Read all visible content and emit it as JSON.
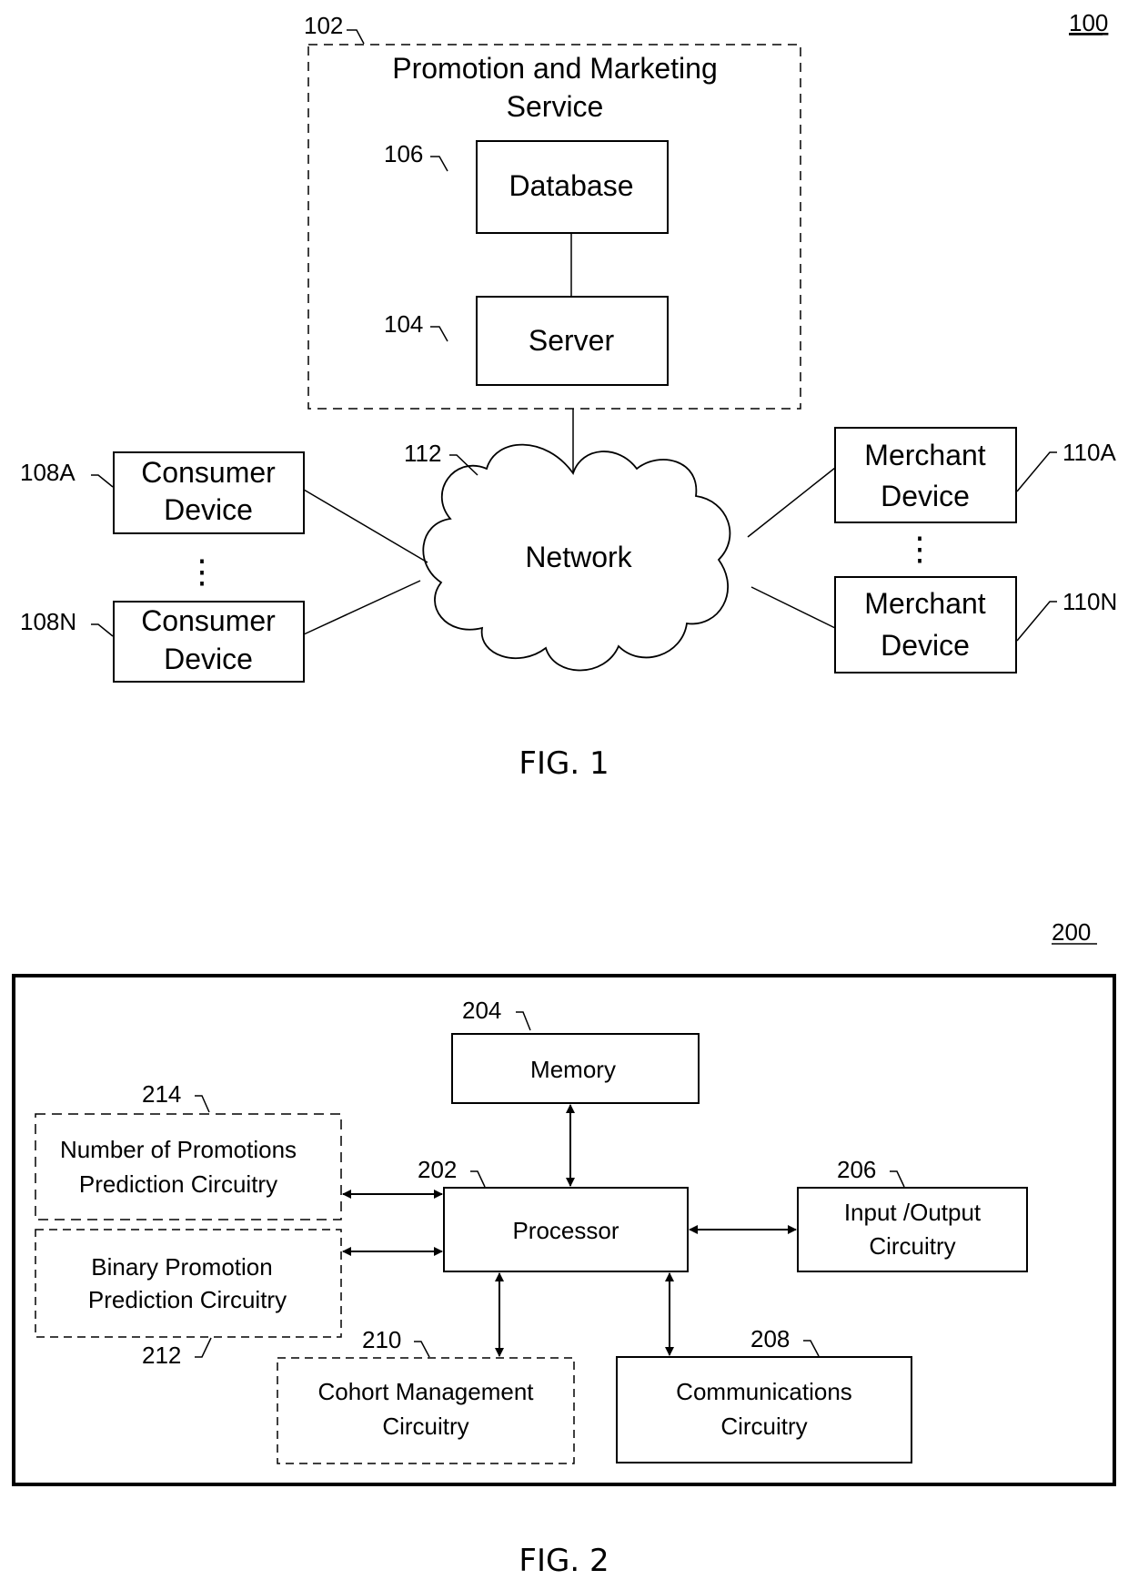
{
  "fig1": {
    "ref": "100",
    "caption": "FIG. 1",
    "service": {
      "ref": "102",
      "title_line1": "Promotion and Marketing",
      "title_line2": "Service"
    },
    "database": {
      "ref": "106",
      "label": "Database"
    },
    "server": {
      "ref": "104",
      "label": "Server"
    },
    "network": {
      "ref": "112",
      "label": "Network"
    },
    "consumer_a": {
      "ref": "108A",
      "line1": "Consumer",
      "line2": "Device"
    },
    "consumer_n": {
      "ref": "108N",
      "line1": "Consumer",
      "line2": "Device"
    },
    "merchant_a": {
      "ref": "110A",
      "line1": "Merchant",
      "line2": "Device"
    },
    "merchant_n": {
      "ref": "110N",
      "line1": "Merchant",
      "line2": "Device"
    },
    "ellipsis": "⋮"
  },
  "fig2": {
    "ref": "200",
    "caption": "FIG. 2",
    "memory": {
      "ref": "204",
      "label": "Memory"
    },
    "processor": {
      "ref": "202",
      "label": "Processor"
    },
    "io": {
      "ref": "206",
      "line1": "Input /Output",
      "line2": "Circuitry"
    },
    "comms": {
      "ref": "208",
      "line1": "Communications",
      "line2": "Circuitry"
    },
    "cohort": {
      "ref": "210",
      "line1": "Cohort Management",
      "line2": "Circuitry"
    },
    "binary": {
      "ref": "212",
      "line1": "Binary Promotion",
      "line2": "Prediction Circuitry"
    },
    "number": {
      "ref": "214",
      "line1": "Number of Promotions",
      "line2": "Prediction Circuitry"
    }
  }
}
